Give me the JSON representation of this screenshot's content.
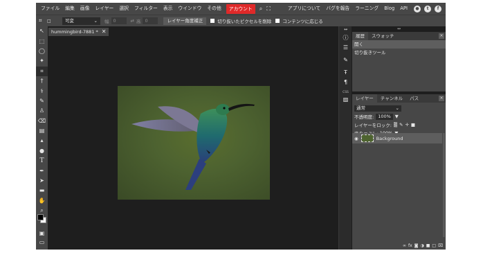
{
  "menubar": {
    "items": [
      "ファイル",
      "編集",
      "画像",
      "レイヤー",
      "選択",
      "フィルター",
      "表示",
      "ウインドウ",
      "その他"
    ],
    "account": "アカウント",
    "right_items": [
      "アプリについて",
      "バグを報告",
      "ラーニング",
      "Blog",
      "API"
    ],
    "accent_color": "#e02929"
  },
  "options": {
    "style_select": "可変",
    "width_label": "幅",
    "width_value": "0",
    "height_label": "高",
    "height_value": "0",
    "straighten_button": "レイヤー角度補正",
    "delete_cropped_label": "切り抜いたピクセルを削除",
    "fit_content_label": "コンテンツに応じる"
  },
  "document": {
    "tab_title": "hummingbird-7881 *",
    "image_subject": "hummingbird"
  },
  "midbar": {
    "css_label": "CSS"
  },
  "history_panel": {
    "tabs": [
      "履歴",
      "スウォッチ"
    ],
    "rows": [
      "開く",
      "切り抜きツール"
    ]
  },
  "layers_panel": {
    "tabs": [
      "レイヤー",
      "チャンネル",
      "パス"
    ],
    "blend_mode": "通常",
    "opacity_label": "不透明度:",
    "opacity_value": "100%",
    "lock_label": "レイヤーをロック:",
    "fill_label": "塗りつぶし:",
    "fill_value": "100%",
    "layer_name": "Background",
    "footer_icons": [
      "eff",
      "fx",
      "mask",
      "adjust",
      "folder",
      "new",
      "trash"
    ]
  }
}
